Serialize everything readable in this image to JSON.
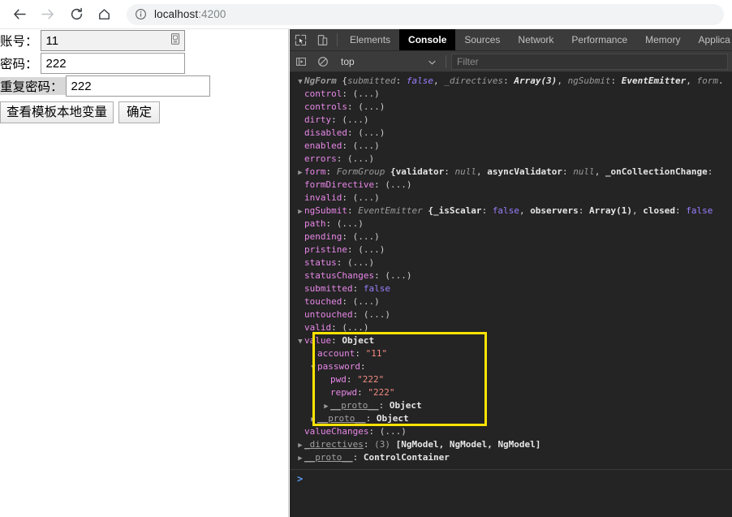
{
  "browser": {
    "nav": {
      "back": "back-arrow",
      "forward": "forward-arrow",
      "reload": "reload-arrow",
      "home": "home-house"
    },
    "omnibox": {
      "info_icon": "info-circle-icon",
      "url_host": "localhost",
      "url_port": ":4200"
    }
  },
  "page": {
    "fields": [
      {
        "label": "账号：",
        "value": "11",
        "name": "account"
      },
      {
        "label": "密码：",
        "value": "222",
        "name": "password"
      },
      {
        "label": "重复密码：",
        "value": "222",
        "name": "repassword"
      }
    ],
    "buttons": [
      {
        "label": "查看模板本地变量",
        "name": "view-template-local-var"
      },
      {
        "label": "确定",
        "name": "submit"
      }
    ],
    "autofill_icon": "autofill-icon"
  },
  "devtools": {
    "icons": {
      "inspect": "inspect-element-icon",
      "device": "device-toolbar-icon",
      "sidebar": "console-sidebar-icon",
      "clear": "clear-console-icon",
      "caret": "chevron-down-icon"
    },
    "tabs": [
      {
        "label": "Elements",
        "active": false
      },
      {
        "label": "Console",
        "active": true
      },
      {
        "label": "Sources",
        "active": false
      },
      {
        "label": "Network",
        "active": false
      },
      {
        "label": "Performance",
        "active": false
      },
      {
        "label": "Memory",
        "active": false
      },
      {
        "label": "Applica",
        "active": false
      }
    ],
    "context": "top",
    "filter_placeholder": "Filter",
    "prompt": ">",
    "highlight_color": "#ffe300",
    "console_lines": [
      {
        "indent": 0,
        "tri": "▼",
        "parts": [
          {
            "t": "NgForm ",
            "c": "v-cls b"
          },
          {
            "t": "{",
            "c": "v-txt"
          },
          {
            "t": "submitted",
            "c": "v-cls"
          },
          {
            "t": ": ",
            "c": "v-txt"
          },
          {
            "t": "false",
            "c": "v-bool it"
          },
          {
            "t": ", ",
            "c": "v-txt"
          },
          {
            "t": "_directives",
            "c": "v-cls"
          },
          {
            "t": ": ",
            "c": "v-txt"
          },
          {
            "t": "Array(3)",
            "c": "v-bold it"
          },
          {
            "t": ", ",
            "c": "v-txt"
          },
          {
            "t": "ngSubmit",
            "c": "v-cls"
          },
          {
            "t": ": ",
            "c": "v-txt"
          },
          {
            "t": "EventEmitter",
            "c": "v-bold it"
          },
          {
            "t": ", ",
            "c": "v-txt"
          },
          {
            "t": "form",
            "c": "v-cls"
          },
          {
            "t": ".",
            "c": "v-txt"
          }
        ]
      },
      {
        "indent": 1,
        "tri": "",
        "parts": [
          {
            "t": "control",
            "c": "k-prop"
          },
          {
            "t": ": ",
            "c": "v-txt"
          },
          {
            "t": "(...)",
            "c": "v-dots"
          }
        ]
      },
      {
        "indent": 1,
        "tri": "",
        "parts": [
          {
            "t": "controls",
            "c": "k-prop"
          },
          {
            "t": ": ",
            "c": "v-txt"
          },
          {
            "t": "(...)",
            "c": "v-dots"
          }
        ]
      },
      {
        "indent": 1,
        "tri": "",
        "parts": [
          {
            "t": "dirty",
            "c": "k-prop"
          },
          {
            "t": ": ",
            "c": "v-txt"
          },
          {
            "t": "(...)",
            "c": "v-dots"
          }
        ]
      },
      {
        "indent": 1,
        "tri": "",
        "parts": [
          {
            "t": "disabled",
            "c": "k-prop"
          },
          {
            "t": ": ",
            "c": "v-txt"
          },
          {
            "t": "(...)",
            "c": "v-dots"
          }
        ]
      },
      {
        "indent": 1,
        "tri": "",
        "parts": [
          {
            "t": "enabled",
            "c": "k-prop"
          },
          {
            "t": ": ",
            "c": "v-txt"
          },
          {
            "t": "(...)",
            "c": "v-dots"
          }
        ]
      },
      {
        "indent": 1,
        "tri": "",
        "parts": [
          {
            "t": "errors",
            "c": "k-prop"
          },
          {
            "t": ": ",
            "c": "v-txt"
          },
          {
            "t": "(...)",
            "c": "v-dots"
          }
        ]
      },
      {
        "indent": 1,
        "tri": "▶",
        "parts": [
          {
            "t": "form",
            "c": "k-prop"
          },
          {
            "t": ": ",
            "c": "v-txt"
          },
          {
            "t": "FormGroup ",
            "c": "v-cls"
          },
          {
            "t": "{",
            "c": "v-bold"
          },
          {
            "t": "validator",
            "c": "v-bold"
          },
          {
            "t": ": ",
            "c": "v-txt"
          },
          {
            "t": "null",
            "c": "v-cls"
          },
          {
            "t": ", ",
            "c": "v-txt"
          },
          {
            "t": "asyncValidator",
            "c": "v-bold"
          },
          {
            "t": ": ",
            "c": "v-txt"
          },
          {
            "t": "null",
            "c": "v-cls"
          },
          {
            "t": ", ",
            "c": "v-txt"
          },
          {
            "t": "_onCollectionChange",
            "c": "v-bold"
          },
          {
            "t": ":",
            "c": "v-txt"
          }
        ]
      },
      {
        "indent": 1,
        "tri": "",
        "parts": [
          {
            "t": "formDirective",
            "c": "k-prop"
          },
          {
            "t": ": ",
            "c": "v-txt"
          },
          {
            "t": "(...)",
            "c": "v-dots"
          }
        ]
      },
      {
        "indent": 1,
        "tri": "",
        "parts": [
          {
            "t": "invalid",
            "c": "k-prop"
          },
          {
            "t": ": ",
            "c": "v-txt"
          },
          {
            "t": "(...)",
            "c": "v-dots"
          }
        ]
      },
      {
        "indent": 1,
        "tri": "▶",
        "parts": [
          {
            "t": "ngSubmit",
            "c": "k-prop"
          },
          {
            "t": ": ",
            "c": "v-txt"
          },
          {
            "t": "EventEmitter ",
            "c": "v-cls"
          },
          {
            "t": "{",
            "c": "v-bold"
          },
          {
            "t": "_isScalar",
            "c": "v-bold"
          },
          {
            "t": ": ",
            "c": "v-txt"
          },
          {
            "t": "false",
            "c": "v-bool"
          },
          {
            "t": ", ",
            "c": "v-txt"
          },
          {
            "t": "observers",
            "c": "v-bold"
          },
          {
            "t": ": ",
            "c": "v-txt"
          },
          {
            "t": "Array(1)",
            "c": "v-bold"
          },
          {
            "t": ", ",
            "c": "v-txt"
          },
          {
            "t": "closed",
            "c": "v-bold"
          },
          {
            "t": ": ",
            "c": "v-txt"
          },
          {
            "t": "false",
            "c": "v-bool"
          }
        ]
      },
      {
        "indent": 1,
        "tri": "",
        "parts": [
          {
            "t": "path",
            "c": "k-prop"
          },
          {
            "t": ": ",
            "c": "v-txt"
          },
          {
            "t": "(...)",
            "c": "v-dots"
          }
        ]
      },
      {
        "indent": 1,
        "tri": "",
        "parts": [
          {
            "t": "pending",
            "c": "k-prop"
          },
          {
            "t": ": ",
            "c": "v-txt"
          },
          {
            "t": "(...)",
            "c": "v-dots"
          }
        ]
      },
      {
        "indent": 1,
        "tri": "",
        "parts": [
          {
            "t": "pristine",
            "c": "k-prop"
          },
          {
            "t": ": ",
            "c": "v-txt"
          },
          {
            "t": "(...)",
            "c": "v-dots"
          }
        ]
      },
      {
        "indent": 1,
        "tri": "",
        "parts": [
          {
            "t": "status",
            "c": "k-prop"
          },
          {
            "t": ": ",
            "c": "v-txt"
          },
          {
            "t": "(...)",
            "c": "v-dots"
          }
        ]
      },
      {
        "indent": 1,
        "tri": "",
        "parts": [
          {
            "t": "statusChanges",
            "c": "k-prop"
          },
          {
            "t": ": ",
            "c": "v-txt"
          },
          {
            "t": "(...)",
            "c": "v-dots"
          }
        ]
      },
      {
        "indent": 1,
        "tri": "",
        "parts": [
          {
            "t": "submitted",
            "c": "k-prop"
          },
          {
            "t": ": ",
            "c": "v-txt"
          },
          {
            "t": "false",
            "c": "v-bool"
          }
        ]
      },
      {
        "indent": 1,
        "tri": "",
        "parts": [
          {
            "t": "touched",
            "c": "k-prop"
          },
          {
            "t": ": ",
            "c": "v-txt"
          },
          {
            "t": "(...)",
            "c": "v-dots"
          }
        ]
      },
      {
        "indent": 1,
        "tri": "",
        "parts": [
          {
            "t": "untouched",
            "c": "k-prop"
          },
          {
            "t": ": ",
            "c": "v-txt"
          },
          {
            "t": "(...)",
            "c": "v-dots"
          }
        ]
      },
      {
        "indent": 1,
        "tri": "",
        "parts": [
          {
            "t": "valid",
            "c": "k-prop"
          },
          {
            "t": ": ",
            "c": "v-txt"
          },
          {
            "t": "(...)",
            "c": "v-dots"
          }
        ]
      },
      {
        "indent": 1,
        "tri": "▼",
        "parts": [
          {
            "t": "value",
            "c": "k-prop"
          },
          {
            "t": ": ",
            "c": "v-txt"
          },
          {
            "t": "Object",
            "c": "v-obj b"
          }
        ]
      },
      {
        "indent": 2,
        "tri": "",
        "parts": [
          {
            "t": "account",
            "c": "k-prop"
          },
          {
            "t": ": ",
            "c": "v-txt"
          },
          {
            "t": "\"11\"",
            "c": "v-str"
          }
        ]
      },
      {
        "indent": 2,
        "tri": "▼",
        "parts": [
          {
            "t": "password",
            "c": "k-prop"
          },
          {
            "t": ":",
            "c": "v-txt"
          }
        ]
      },
      {
        "indent": 3,
        "tri": "",
        "parts": [
          {
            "t": "pwd",
            "c": "k-prop"
          },
          {
            "t": ": ",
            "c": "v-txt"
          },
          {
            "t": "\"222\"",
            "c": "v-str"
          }
        ]
      },
      {
        "indent": 3,
        "tri": "",
        "parts": [
          {
            "t": "repwd",
            "c": "k-prop"
          },
          {
            "t": ": ",
            "c": "v-txt"
          },
          {
            "t": "\"222\"",
            "c": "v-str"
          }
        ]
      },
      {
        "indent": 3,
        "tri": "▶",
        "parts": [
          {
            "t": "__proto__",
            "c": "k-int"
          },
          {
            "t": ": ",
            "c": "v-txt"
          },
          {
            "t": "Object",
            "c": "v-obj b"
          }
        ]
      },
      {
        "indent": 2,
        "tri": "▶",
        "parts": [
          {
            "t": "__proto__",
            "c": "k-int"
          },
          {
            "t": ": ",
            "c": "v-txt"
          },
          {
            "t": "Object",
            "c": "v-obj b"
          }
        ]
      },
      {
        "indent": 1,
        "tri": "",
        "parts": [
          {
            "t": "valueChanges",
            "c": "k-prop"
          },
          {
            "t": ": ",
            "c": "v-txt"
          },
          {
            "t": "(...)",
            "c": "v-dots"
          }
        ]
      },
      {
        "indent": 1,
        "tri": "▶",
        "parts": [
          {
            "t": "_directives",
            "c": "k-int"
          },
          {
            "t": ": ",
            "c": "v-txt"
          },
          {
            "t": "(3) ",
            "c": "k-dim"
          },
          {
            "t": "[NgModel, NgModel, NgModel]",
            "c": "v-obj b"
          }
        ]
      },
      {
        "indent": 1,
        "tri": "▶",
        "parts": [
          {
            "t": "__proto__",
            "c": "k-int"
          },
          {
            "t": ": ",
            "c": "v-txt"
          },
          {
            "t": "ControlContainer",
            "c": "v-obj b"
          }
        ]
      }
    ]
  }
}
